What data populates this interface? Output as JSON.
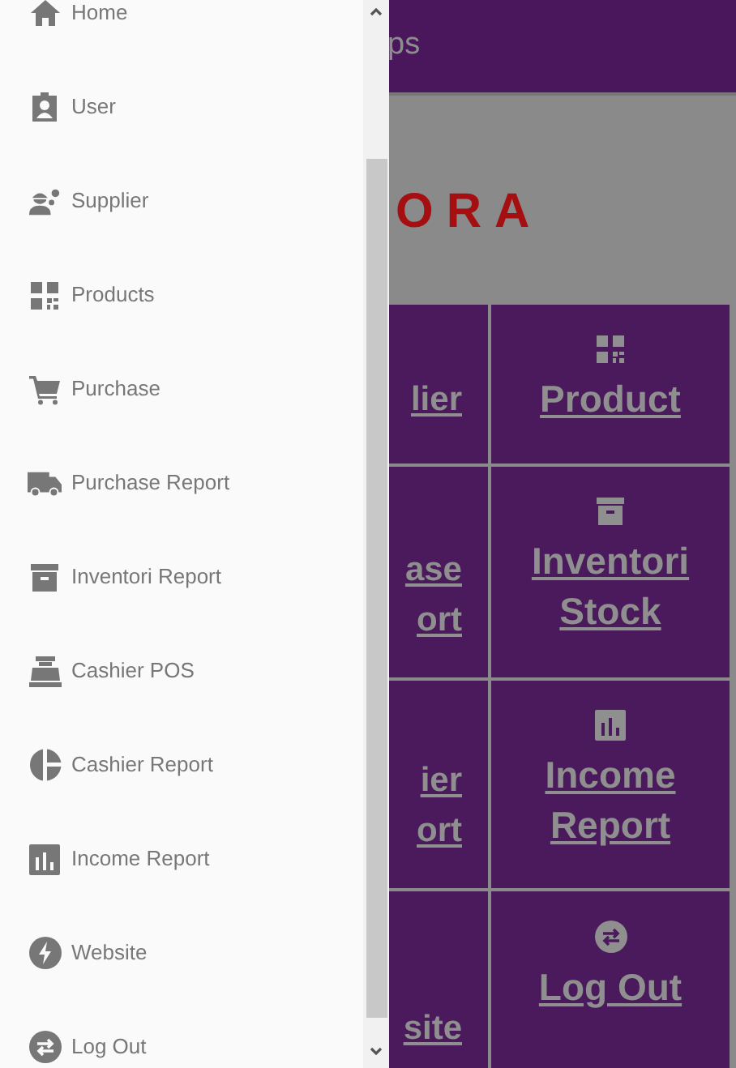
{
  "sidebar": {
    "items": [
      {
        "label": "Home"
      },
      {
        "label": "User"
      },
      {
        "label": "Supplier"
      },
      {
        "label": "Products"
      },
      {
        "label": "Purchase"
      },
      {
        "label": "Purchase Report"
      },
      {
        "label": "Inventori Report"
      },
      {
        "label": "Cashier POS"
      },
      {
        "label": "Cashier Report"
      },
      {
        "label": "Income Report"
      },
      {
        "label": "Website"
      },
      {
        "label": "Log Out"
      }
    ]
  },
  "header": {
    "title": "ps"
  },
  "banner": {
    "logo_text": "ORA"
  },
  "tiles": [
    {
      "cut_lines": [
        "lier"
      ],
      "label": "Product"
    },
    {
      "cut_lines": [
        "ase",
        "ort"
      ],
      "label": "Inventori Stock"
    },
    {
      "cut_lines": [
        "ier",
        "ort"
      ],
      "label": "Income Report"
    },
    {
      "cut_lines": [
        "site"
      ],
      "label": "Log Out"
    }
  ]
}
